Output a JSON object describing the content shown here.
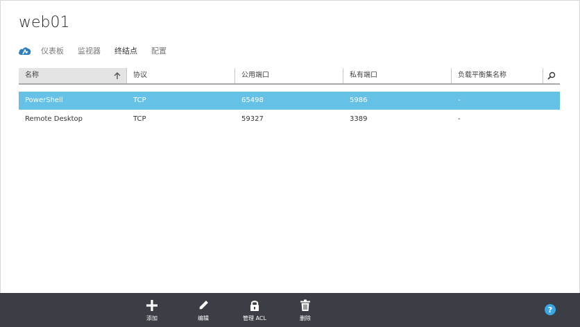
{
  "page": {
    "title": "web01"
  },
  "nav": {
    "cloud_icon": "cloud-service-icon",
    "tabs": [
      {
        "label": "仪表板",
        "active": false
      },
      {
        "label": "监视器",
        "active": false
      },
      {
        "label": "终结点",
        "active": true
      },
      {
        "label": "配置",
        "active": false
      }
    ]
  },
  "table": {
    "columns": [
      {
        "label": "名称",
        "sorted": "ascending"
      },
      {
        "label": "协议"
      },
      {
        "label": "公用端口"
      },
      {
        "label": "私有端口"
      },
      {
        "label": "负载平衡集名称"
      }
    ],
    "search_icon": "search-icon",
    "rows": [
      {
        "name": "PowerShell",
        "protocol": "TCP",
        "public_port": "65498",
        "private_port": "5986",
        "lb_set": "-",
        "selected": true
      },
      {
        "name": "Remote Desktop",
        "protocol": "TCP",
        "public_port": "59327",
        "private_port": "3389",
        "lb_set": "-",
        "selected": false
      }
    ]
  },
  "commandbar": {
    "add": {
      "label": "添加",
      "icon": "plus-icon"
    },
    "edit": {
      "label": "编辑",
      "icon": "pencil-icon"
    },
    "acl": {
      "label": "管理 ACL",
      "icon": "lock-icon"
    },
    "delete": {
      "label": "删除",
      "icon": "trash-icon"
    },
    "help": {
      "label": "?",
      "icon": "help-icon"
    }
  },
  "colors": {
    "selected_row": "#65c1e6",
    "command_bar": "#3b3e45",
    "accent": "#3ba6e6"
  }
}
